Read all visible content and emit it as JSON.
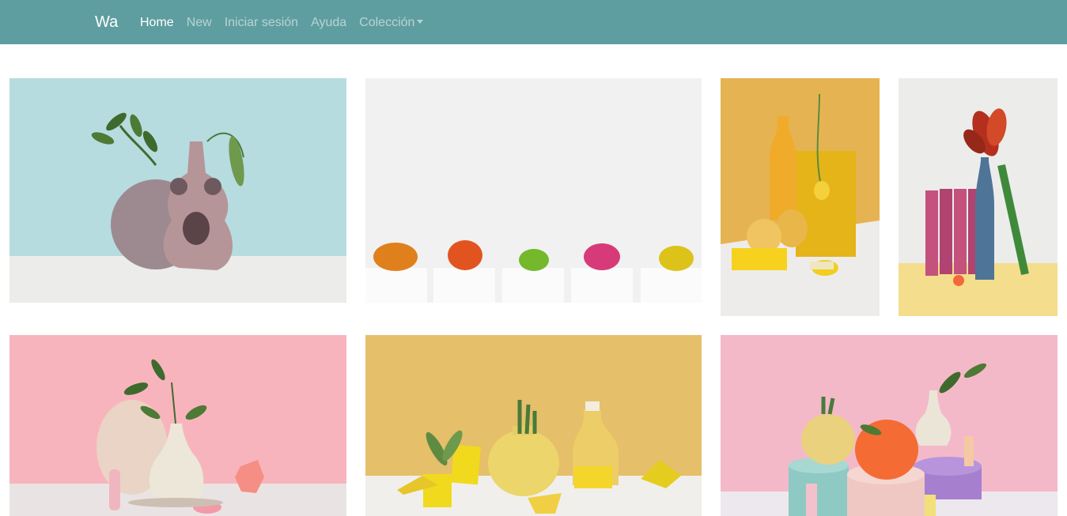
{
  "navbar": {
    "brand": "Wa",
    "items": [
      {
        "label": "Home",
        "active": true
      },
      {
        "label": "New"
      },
      {
        "label": "Iniciar sesión"
      },
      {
        "label": "Ayuda"
      },
      {
        "label": "Colección",
        "dropdown": true
      }
    ],
    "color": "#5f9ea0"
  },
  "gallery": {
    "photos": [
      {
        "subject": "pink ceramic vase with green leaves on light blue background"
      },
      {
        "subject": "row of colorful cacti in white pots on white background"
      },
      {
        "subject": "yellow bottle vase with yellow flower and geometric shapes"
      },
      {
        "subject": "blue vase with red tulip and pink books on pastel background"
      },
      {
        "subject": "cream vase with leafy branch on pink background with pebbles"
      },
      {
        "subject": "yellow pots with succulents and geometric blocks on ochre background"
      },
      {
        "subject": "orange and yellow pots with succulents on pastel cylinders, pink background"
      }
    ]
  }
}
